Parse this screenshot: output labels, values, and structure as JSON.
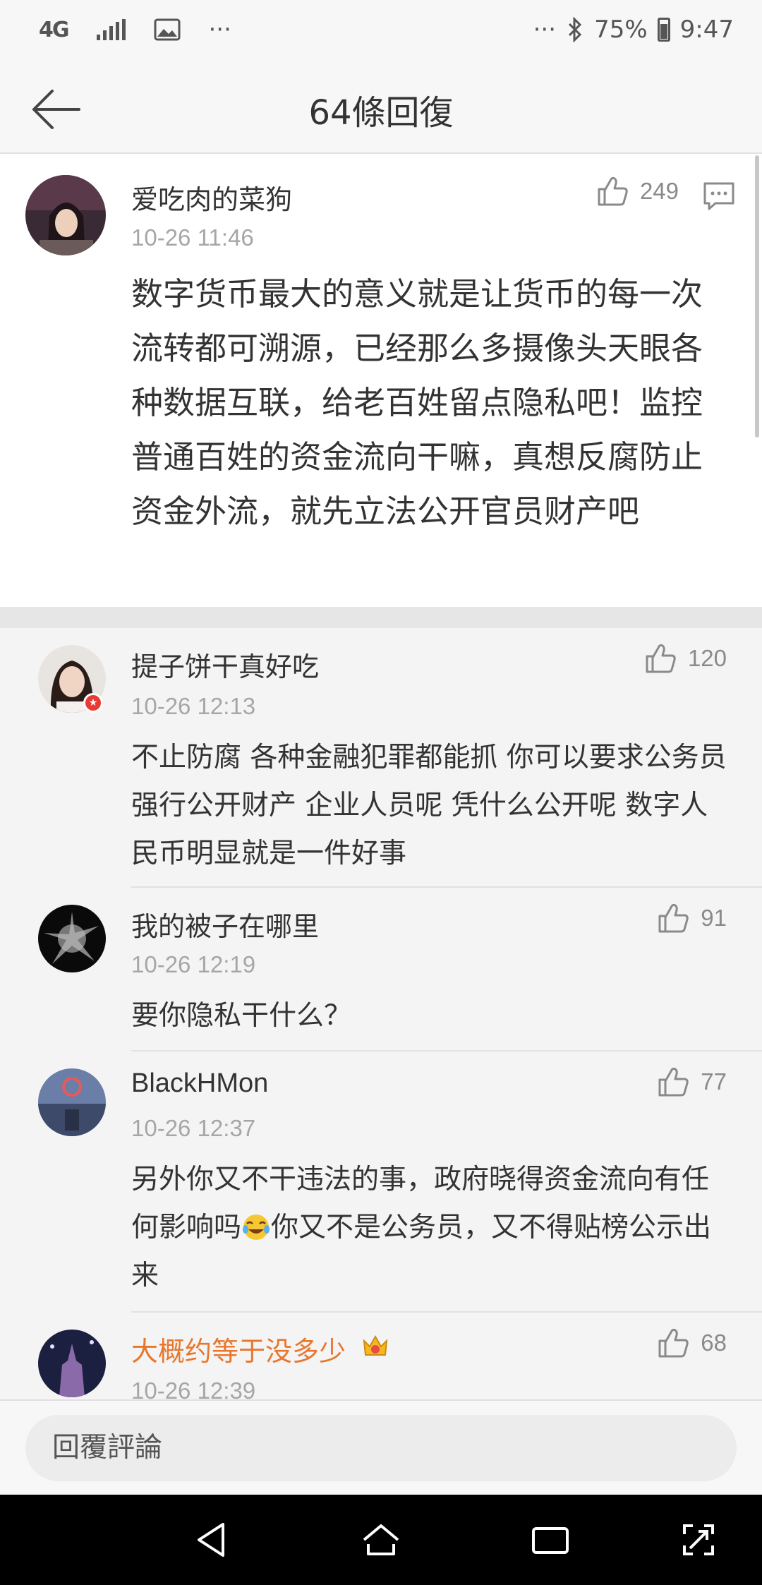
{
  "status_bar": {
    "network": "4G",
    "more_left": "···",
    "more_right": "···",
    "battery": "75%",
    "time": "9:47"
  },
  "header": {
    "title": "64條回復"
  },
  "main_post": {
    "username": "爱吃肉的菜狗",
    "time": "10-26 11:46",
    "likes": "249",
    "text": "数字货币最大的意义就是让货币的每一次流转都可溯源，已经那么多摄像头天眼各种数据互联，给老百姓留点隐私吧！监控普通百姓的资金流向干嘛，真想反腐防止资金外流，就先立法公开官员财产吧"
  },
  "comments": [
    {
      "username": "提子饼干真好吃",
      "time": "10-26 12:13",
      "likes": "120",
      "text": "不止防腐 各种金融犯罪都能抓 你可以要求公务员强行公开财产 企业人员呢 凭什么公开呢 数字人民币明显就是一件好事"
    },
    {
      "username": "我的被子在哪里",
      "time": "10-26 12:19",
      "likes": "91",
      "text": "要你隐私干什么？"
    },
    {
      "username": "BlackHMon",
      "time": "10-26 12:37",
      "likes": "77",
      "text_before_emoji": "另外你又不干违法的事，政府晓得资金流向有任何影响吗",
      "text_after_emoji": "你又不是公务员，又不得贴榜公示出来"
    },
    {
      "username": "大概约等于没多少",
      "time": "10-26 12:39",
      "likes": "68",
      "username_color": "#e8772e"
    }
  ],
  "reply_bar": {
    "placeholder": "回覆評論"
  },
  "colors": {
    "highlight_username": "#e8772e",
    "muted": "#a6a6a6"
  }
}
